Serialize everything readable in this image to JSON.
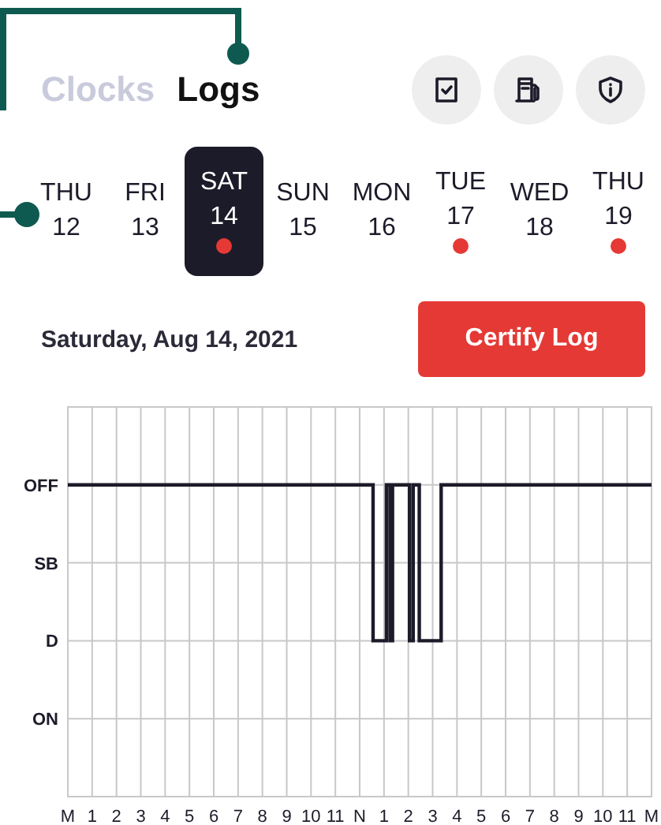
{
  "tabs": [
    {
      "label": "Clocks",
      "selected": false
    },
    {
      "label": "Logs",
      "selected": true
    }
  ],
  "toolbar": [
    {
      "kind": "inspection"
    },
    {
      "kind": "fuel"
    },
    {
      "kind": "shield"
    }
  ],
  "days": [
    {
      "weekday": "THU",
      "date": "12",
      "selected": false,
      "has_log": false
    },
    {
      "weekday": "FRI",
      "date": "13",
      "selected": false,
      "has_log": false
    },
    {
      "weekday": "SAT",
      "date": "14",
      "selected": true,
      "has_log": true
    },
    {
      "weekday": "SUN",
      "date": "15",
      "selected": false,
      "has_log": false
    },
    {
      "weekday": "MON",
      "date": "16",
      "selected": false,
      "has_log": false
    },
    {
      "weekday": "TUE",
      "date": "17",
      "selected": false,
      "has_log": true
    },
    {
      "weekday": "WED",
      "date": "18",
      "selected": false,
      "has_log": false
    },
    {
      "weekday": "THU",
      "date": "19",
      "selected": false,
      "has_log": true
    }
  ],
  "date_label": "Saturday, Aug 14, 2021",
  "certify_button": "Certify Log",
  "log_graph": {
    "status_labels": [
      "OFF",
      "SB",
      "D",
      "ON"
    ],
    "hour_labels": [
      "M",
      "1",
      "2",
      "3",
      "4",
      "5",
      "6",
      "7",
      "8",
      "9",
      "10",
      "11",
      "N",
      "1",
      "2",
      "3",
      "4",
      "5",
      "6",
      "7",
      "8",
      "9",
      "10",
      "11",
      "M"
    ]
  }
}
